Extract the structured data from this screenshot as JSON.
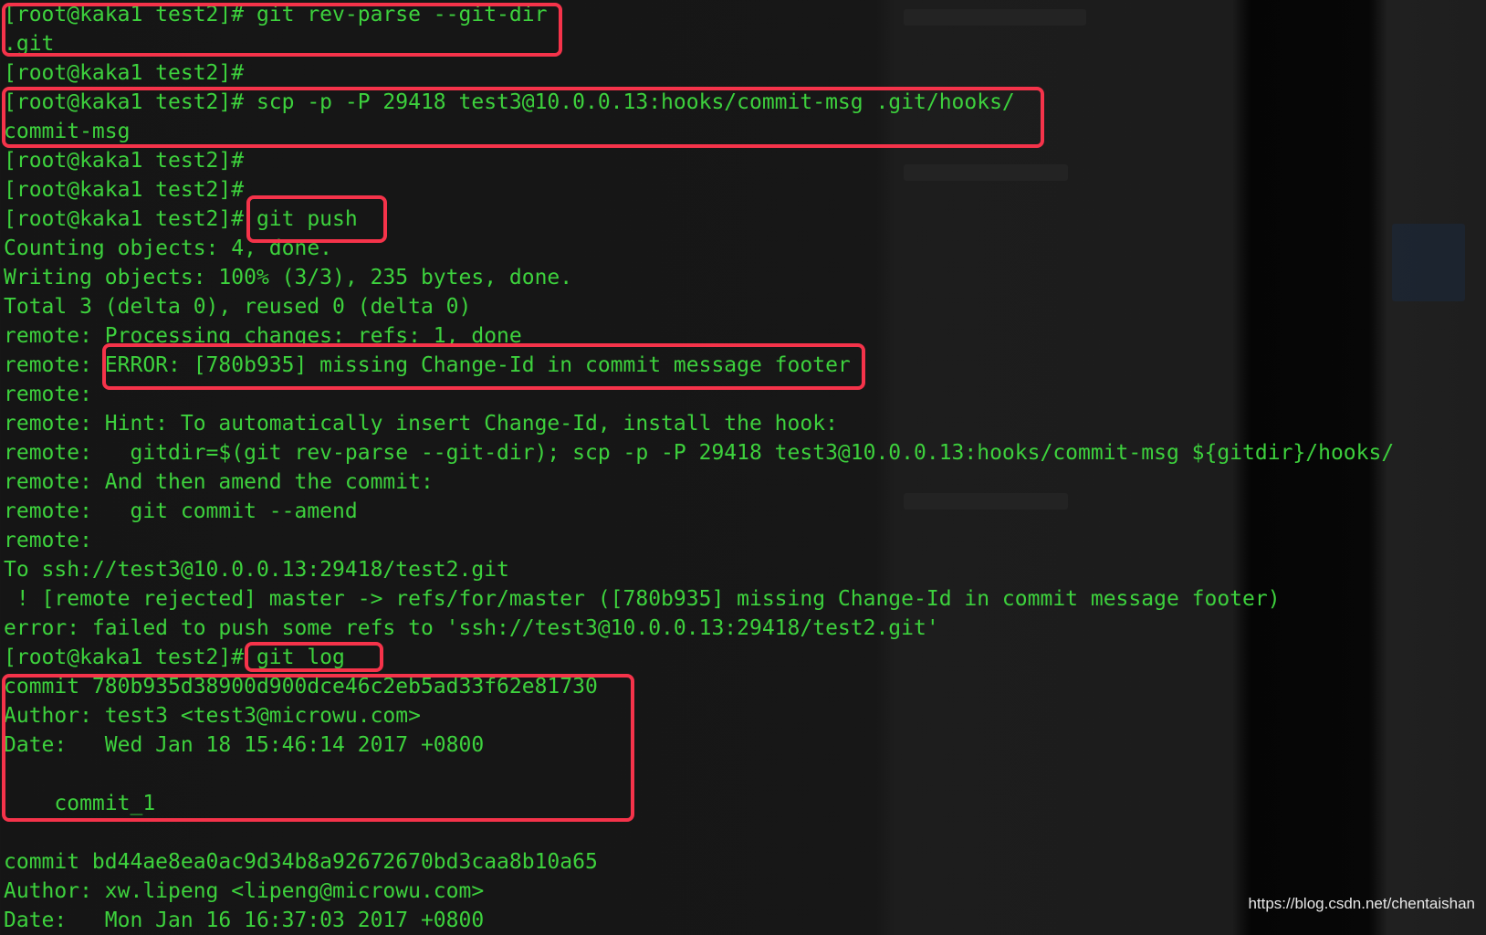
{
  "terminal": {
    "lines": [
      "[root@kaka1 test2]# git rev-parse --git-dir",
      ".git",
      "[root@kaka1 test2]#",
      "[root@kaka1 test2]# scp -p -P 29418 test3@10.0.0.13:hooks/commit-msg .git/hooks/",
      "commit-msg",
      "[root@kaka1 test2]#",
      "[root@kaka1 test2]#",
      "[root@kaka1 test2]# git push",
      "Counting objects: 4, done.",
      "Writing objects: 100% (3/3), 235 bytes, done.",
      "Total 3 (delta 0), reused 0 (delta 0)",
      "remote: Processing changes: refs: 1, done",
      "remote: ERROR: [780b935] missing Change-Id in commit message footer",
      "remote:",
      "remote: Hint: To automatically insert Change-Id, install the hook:",
      "remote:   gitdir=$(git rev-parse --git-dir); scp -p -P 29418 test3@10.0.0.13:hooks/commit-msg ${gitdir}/hooks/",
      "remote: And then amend the commit:",
      "remote:   git commit --amend",
      "remote:",
      "To ssh://test3@10.0.0.13:29418/test2.git",
      " ! [remote rejected] master -> refs/for/master ([780b935] missing Change-Id in commit message footer)",
      "error: failed to push some refs to 'ssh://test3@10.0.0.13:29418/test2.git'",
      "[root@kaka1 test2]# git log",
      "commit 780b935d38900d900dce46c2eb5ad33f62e81730",
      "Author: test3 <test3@microwu.com>",
      "Date:   Wed Jan 18 15:46:14 2017 +0800",
      "",
      "    commit_1",
      "",
      "commit bd44ae8ea0ac9d34b8a92672670bd3caa8b10a65",
      "Author: xw.lipeng <lipeng@microwu.com>",
      "Date:   Mon Jan 16 16:37:03 2017 +0800"
    ]
  },
  "colors": {
    "text": "#3dd13d",
    "highlight_box": "#f5334a",
    "background": "#151515"
  },
  "watermark": "https://blog.csdn.net/chentaishan"
}
